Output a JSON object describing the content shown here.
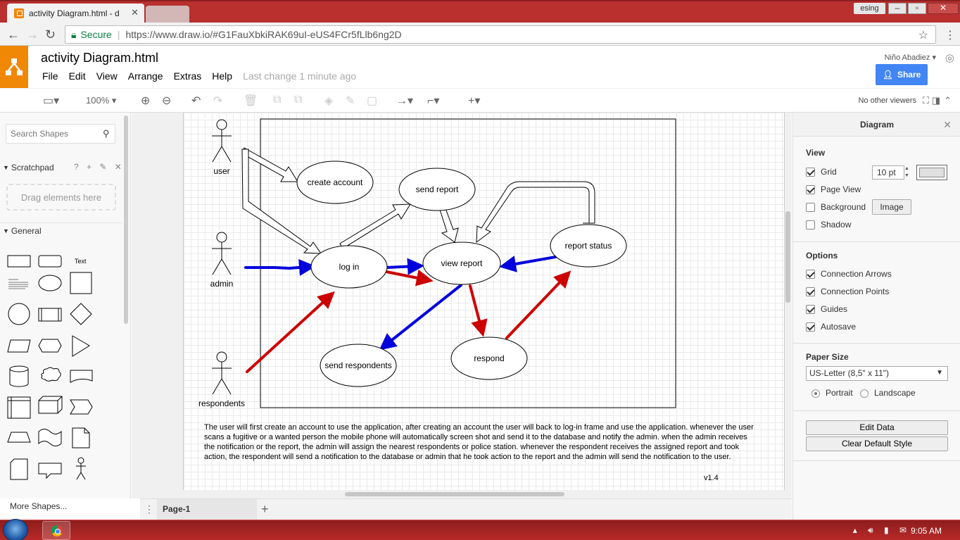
{
  "browser": {
    "tab_title": "activity Diagram.html - d",
    "user_chip": "esing",
    "secure_label": "Secure",
    "url": "https://www.draw.io/#G1FauXbkiRAK69uI-eUS4FCr5fLlb6ng2D"
  },
  "app": {
    "doc_title": "activity Diagram.html",
    "menu": [
      "File",
      "Edit",
      "View",
      "Arrange",
      "Extras",
      "Help"
    ],
    "last_change": "Last change 1 minute ago",
    "username": "Niño Abadiez",
    "share_label": "Share",
    "zoom": "100%",
    "viewers": "No other viewers"
  },
  "left_panel": {
    "search_placeholder": "Search Shapes",
    "scratchpad_title": "Scratchpad",
    "scratchpad_icons": "? + ✎ ✕",
    "drop_hint": "Drag elements here",
    "general_title": "General",
    "text_shape_label": "Text",
    "more_shapes": "More Shapes..."
  },
  "diagram": {
    "actors": {
      "user": "user",
      "admin": "admin",
      "respondents": "respondents"
    },
    "nodes": {
      "create_account": "create account",
      "send_report": "send report",
      "log_in": "log in",
      "view_report": "view report",
      "report_status": "report status",
      "send_respondents": "send respondents",
      "respond": "respond"
    },
    "description": "The user will first create an account to use the application, after creating an account the user will back to log-in frame and use the application. whenever the user scans a fugitive or a wanted person the mobile phone will automatically screen shot and send it to the database and notify the admin. when the admin receives the notification or the report, the admin will assign the nearest respondents or police station. whenever the respondent receives the assigned report and took action, the respondent will send a notification to the database or admin that he took action to the report and the admin will send the notification to the user.",
    "version": "v1.4",
    "colors": {
      "blue_arrow": "#0000dd",
      "red_arrow": "#cc0000"
    }
  },
  "page_tab": "Page-1",
  "right_panel": {
    "title": "Diagram",
    "view_section": "View",
    "grid_label": "Grid",
    "grid_size": "10 pt",
    "page_view_label": "Page View",
    "background_label": "Background",
    "image_button": "Image",
    "shadow_label": "Shadow",
    "options_section": "Options",
    "connection_arrows": "Connection Arrows",
    "connection_points": "Connection Points",
    "guides": "Guides",
    "autosave": "Autosave",
    "paper_size_section": "Paper Size",
    "paper_size": "US-Letter (8,5\" x 11\")",
    "portrait": "Portrait",
    "landscape": "Landscape",
    "edit_data": "Edit Data",
    "clear_default_style": "Clear Default Style"
  },
  "taskbar": {
    "clock": "9:05 AM"
  }
}
